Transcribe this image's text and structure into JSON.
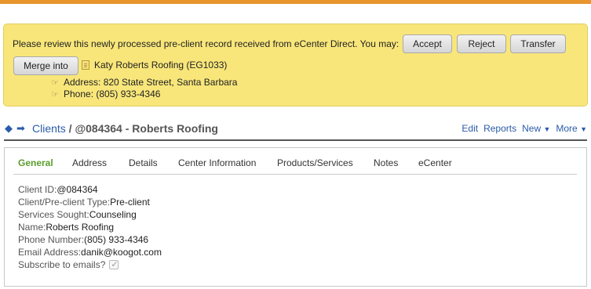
{
  "notice": {
    "message": "Please review this newly processed pre-client record received from eCenter Direct. You may:",
    "buttons": {
      "accept": "Accept",
      "reject": "Reject",
      "transfer": "Transfer",
      "merge": "Merge into"
    },
    "merge_target": "Katy Roberts Roofing (EG1033)",
    "address": "Address: 820 State Street, Santa Barbara",
    "phone": "Phone: (805) 933-4346"
  },
  "breadcrumb": {
    "root": "Clients",
    "separator": " / ",
    "current": "@084364 - Roberts Roofing"
  },
  "actions": {
    "edit": "Edit",
    "reports": "Reports",
    "new": "New",
    "more": "More"
  },
  "tabs": [
    "General",
    "Address",
    "Details",
    "Center Information",
    "Products/Services",
    "Notes",
    "eCenter"
  ],
  "active_tab": "General",
  "fields": [
    {
      "label": "Client ID: ",
      "value": "@084364"
    },
    {
      "label": "Client/Pre-client Type: ",
      "value": "Pre-client"
    },
    {
      "label": "Services Sought: ",
      "value": "Counseling"
    },
    {
      "label": "Name: ",
      "value": "Roberts Roofing"
    },
    {
      "label": "Phone Number: ",
      "value": "(805) 933-4346"
    },
    {
      "label": "Email Address: ",
      "value": "danik@koogot.com"
    },
    {
      "label": "Subscribe to emails? ",
      "value": ""
    }
  ],
  "subscribe_checked": true,
  "colors": {
    "accent_bar": "#e8952d",
    "notice_bg": "#f8e67a",
    "link": "#2a5ba8",
    "active_tab": "#5a9e2e"
  }
}
